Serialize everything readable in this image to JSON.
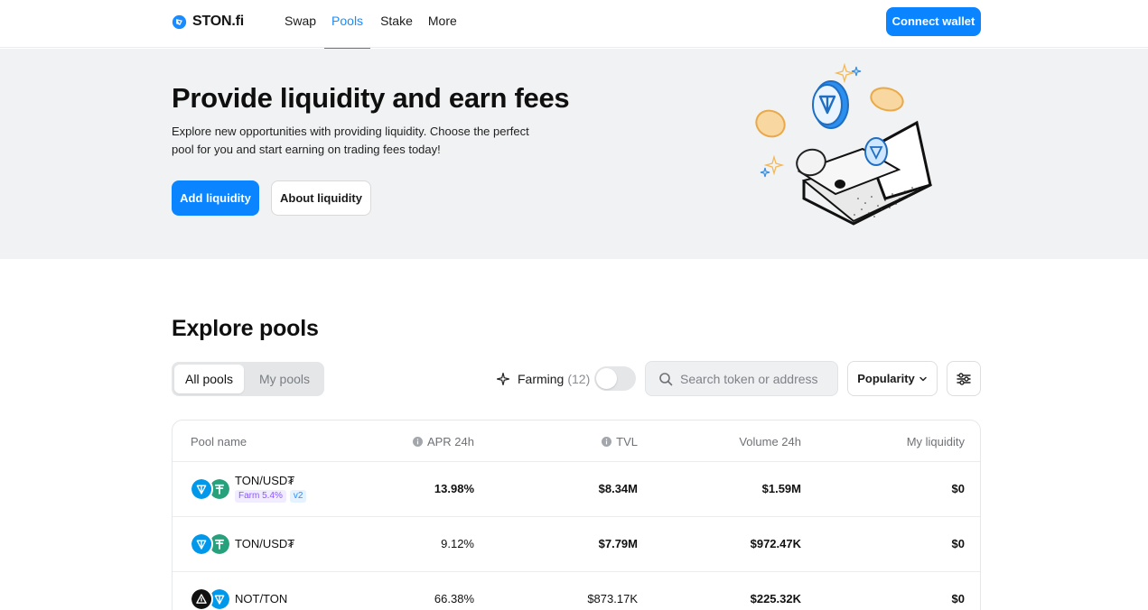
{
  "header": {
    "logo_text": "STON.fi",
    "nav": [
      {
        "label": "Swap",
        "active": false
      },
      {
        "label": "Pools",
        "active": true
      },
      {
        "label": "Stake",
        "active": false
      },
      {
        "label": "More",
        "active": false
      }
    ],
    "connect_label": "Connect wallet"
  },
  "hero": {
    "title": "Provide liquidity and earn fees",
    "description": "Explore new opportunities with providing liquidity. Choose the perfect pool for you and start earning on trading fees today!",
    "add_label": "Add liquidity",
    "about_label": "About liquidity"
  },
  "explore": {
    "title": "Explore pools",
    "tabs": [
      {
        "label": "All pools",
        "active": true
      },
      {
        "label": "My pools",
        "active": false
      }
    ],
    "farming_label": "Farming",
    "farming_count": "(12)",
    "farming_toggle_on": false,
    "search_placeholder": "Search token or address",
    "sort_label": "Popularity"
  },
  "table": {
    "columns": [
      "Pool name",
      "APR 24h",
      "TVL",
      "Volume 24h",
      "My liquidity"
    ],
    "rows": [
      {
        "pair": "TON/USD₮",
        "badges": {
          "farm": "Farm 5.4%",
          "version": "v2"
        },
        "apr": "13.98%",
        "tvl": "$8.34M",
        "volume": "$1.59M",
        "my_liquidity": "$0",
        "tokens": [
          "ton-icon",
          "usdt-icon"
        ]
      },
      {
        "pair": "TON/USD₮",
        "apr": "9.12%",
        "tvl": "$7.79M",
        "volume": "$972.47K",
        "my_liquidity": "$0",
        "tokens": [
          "ton-icon",
          "usdt-icon"
        ]
      },
      {
        "pair": "NOT/TON",
        "apr": "66.38%",
        "tvl": "$873.17K",
        "volume": "$225.32K",
        "my_liquidity": "$0",
        "tokens": [
          "not-icon",
          "ton-icon"
        ]
      }
    ]
  },
  "colors": {
    "accent": "#0a84ff",
    "hero_bg": "#f1f2f3",
    "farm_badge": "#8a58ff",
    "ton": "#0098ea",
    "usdt": "#26a17b"
  }
}
